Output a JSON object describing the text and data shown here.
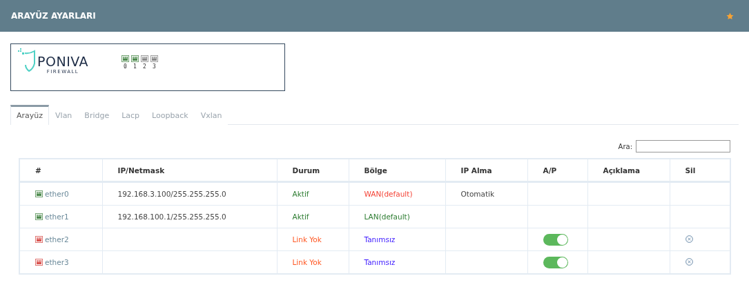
{
  "header": {
    "title": "ARAYÜZ AYARLARI",
    "favorite": true
  },
  "device": {
    "logo_name": "PONIVA",
    "logo_sub": "FIREWALL",
    "ports": [
      {
        "label": "0",
        "up": true
      },
      {
        "label": "1",
        "up": true
      },
      {
        "label": "2",
        "up": false
      },
      {
        "label": "3",
        "up": false
      }
    ]
  },
  "tabs": [
    {
      "label": "Arayüz",
      "selected": true
    },
    {
      "label": "Vlan",
      "selected": false
    },
    {
      "label": "Bridge",
      "selected": false
    },
    {
      "label": "Lacp",
      "selected": false
    },
    {
      "label": "Loopback",
      "selected": false
    },
    {
      "label": "Vxlan",
      "selected": false
    }
  ],
  "search": {
    "label": "Ara:"
  },
  "table": {
    "columns": [
      "#",
      "IP/Netmask",
      "Durum",
      "Bölge",
      "IP Alma",
      "A/P",
      "Açıklama",
      "Sil"
    ],
    "rows": [
      {
        "name": "ether0",
        "up": true,
        "ip": "192.168.3.100/255.255.255.0",
        "status": {
          "text": "Aktif",
          "color": "#2e7d32"
        },
        "zone": {
          "text": "WAN(default)",
          "color": "#f44336"
        },
        "ip_mode": "Otomatik",
        "toggle": false,
        "deletable": false
      },
      {
        "name": "ether1",
        "up": true,
        "ip": "192.168.100.1/255.255.255.0",
        "status": {
          "text": "Aktif",
          "color": "#2e7d32"
        },
        "zone": {
          "text": "LAN(default)",
          "color": "#2e7d32"
        },
        "toggle": false,
        "deletable": false
      },
      {
        "name": "ether2",
        "up": false,
        "status": {
          "text": "Link Yok",
          "color": "#ff5722"
        },
        "zone": {
          "text": "Tanımsız",
          "color": "#3d1aff"
        },
        "toggle": true,
        "on": true,
        "deletable": true
      },
      {
        "name": "ether3",
        "up": false,
        "status": {
          "text": "Link Yok",
          "color": "#ff5722"
        },
        "zone": {
          "text": "Tanımsız",
          "color": "#3d1aff"
        },
        "toggle": true,
        "on": true,
        "deletable": true
      }
    ]
  }
}
